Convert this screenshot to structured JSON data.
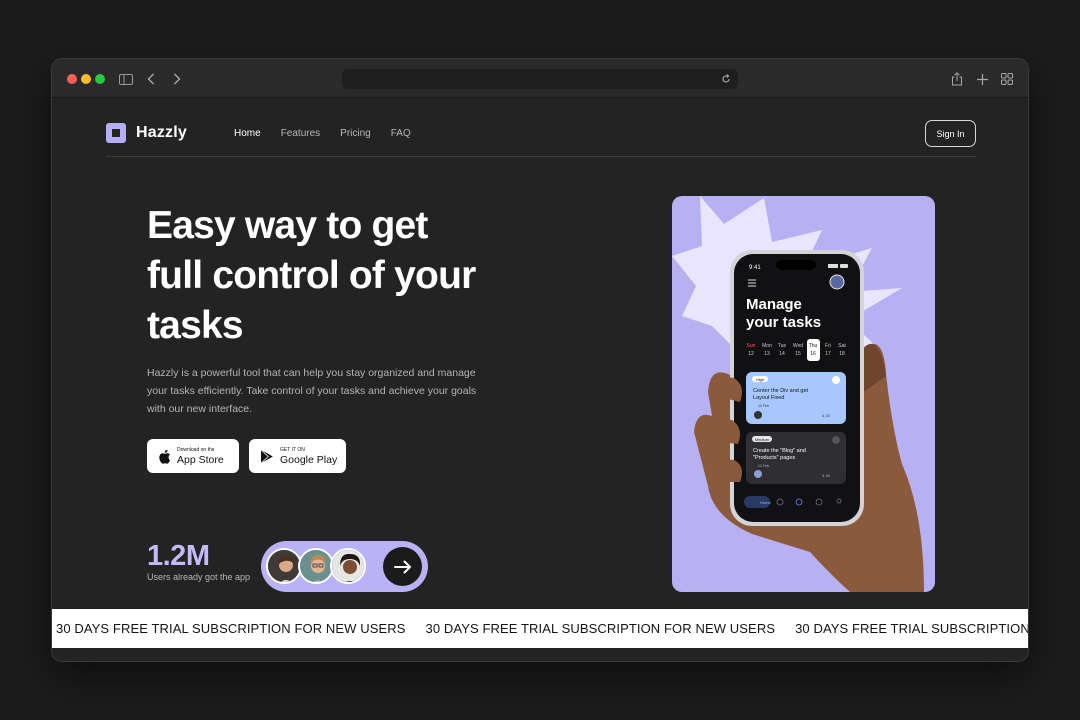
{
  "browser": {
    "traffic_lights": [
      "#ff5f57",
      "#febc2e",
      "#28c840"
    ]
  },
  "brand": {
    "name": "Hazzly",
    "accent": "#b7b1f3"
  },
  "nav": {
    "links": [
      {
        "label": "Home",
        "active": true
      },
      {
        "label": "Features",
        "active": false
      },
      {
        "label": "Pricing",
        "active": false
      },
      {
        "label": "FAQ",
        "active": false
      }
    ],
    "sign_in": "Sign In"
  },
  "hero": {
    "title_line1": "Easy way to get",
    "title_line2": "full control of your",
    "title_line3": "tasks",
    "description": "Hazzly is a powerful tool that can help you stay organized and manage your tasks efficiently. Take control of your tasks and achieve your goals with our new interface.",
    "app_store": {
      "small": "Download on the",
      "big": "App Store"
    },
    "google_play": {
      "small": "GET IT ON",
      "big": "Google Play"
    }
  },
  "stats": {
    "value": "1.2M",
    "label": "Users already got the app"
  },
  "phone": {
    "time": "9:41",
    "heading_line1": "Manage",
    "heading_line2": "your tasks",
    "days": [
      {
        "name": "Sun",
        "num": "12"
      },
      {
        "name": "Mon",
        "num": "13"
      },
      {
        "name": "Tue",
        "num": "14"
      },
      {
        "name": "Wed",
        "num": "15"
      },
      {
        "name": "Thu",
        "num": "16"
      },
      {
        "name": "Fri",
        "num": "17"
      },
      {
        "name": "Sat",
        "num": "18"
      }
    ],
    "tasks": [
      {
        "priority": "High",
        "title_line1": "Center the Div and get",
        "title_line2": "Layout Fixed",
        "date": "10 Feb",
        "meta": "4  15"
      },
      {
        "priority": "Medium",
        "title_line1": "Create the \"Blog\" and",
        "title_line2": "\"Products\" pages",
        "date": "12 Feb",
        "meta": "4  16"
      }
    ],
    "tab_home": "Home"
  },
  "marquee": {
    "text": "30 DAYS FREE TRIAL SUBSCRIPTION FOR NEW USERS"
  }
}
